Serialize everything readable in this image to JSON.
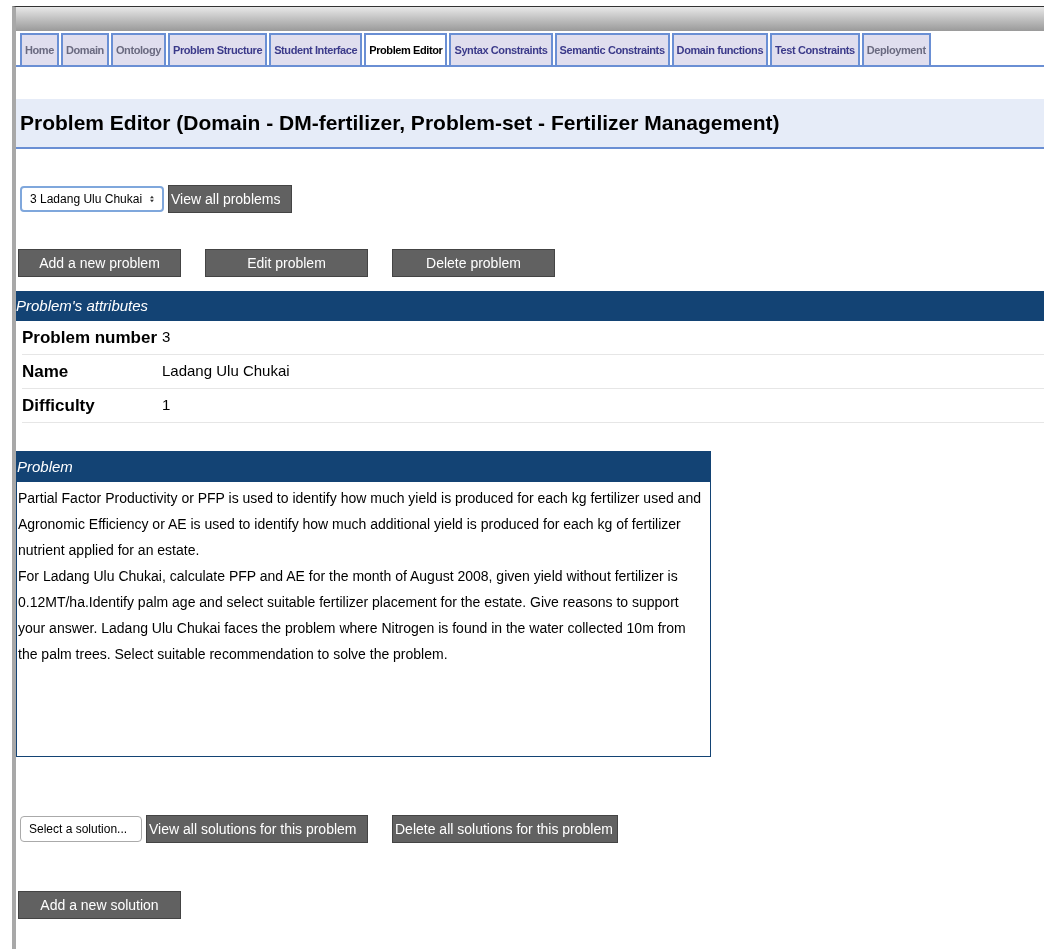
{
  "tabs": [
    {
      "label": "Home",
      "selected": false,
      "dimmed": true
    },
    {
      "label": "Domain",
      "selected": false,
      "dimmed": true
    },
    {
      "label": "Ontology",
      "selected": false,
      "dimmed": true
    },
    {
      "label": "Problem Structure",
      "selected": false,
      "dimmed": false
    },
    {
      "label": "Student Interface",
      "selected": false,
      "dimmed": false
    },
    {
      "label": "Problem Editor",
      "selected": true,
      "dimmed": false
    },
    {
      "label": "Syntax Constraints",
      "selected": false,
      "dimmed": false
    },
    {
      "label": "Semantic Constraints",
      "selected": false,
      "dimmed": false
    },
    {
      "label": "Domain functions",
      "selected": false,
      "dimmed": false
    },
    {
      "label": "Test Constraints",
      "selected": false,
      "dimmed": false
    },
    {
      "label": "Deployment",
      "selected": false,
      "dimmed": true
    }
  ],
  "page_title": "Problem Editor (Domain - DM-fertilizer, Problem-set - Fertilizer Management)",
  "problem_select": {
    "value": "3 Ladang Ulu Chukai"
  },
  "view_all_button": "View all problems",
  "problem_buttons": [
    "Add a new problem",
    "Edit problem",
    "Delete problem"
  ],
  "attributes": {
    "heading": "Problem's attributes",
    "rows": [
      {
        "label": "Problem number",
        "value": "3"
      },
      {
        "label": "Name",
        "value": "Ladang Ulu Chukai"
      },
      {
        "label": "Difficulty",
        "value": "1"
      }
    ]
  },
  "problem": {
    "heading": "Problem",
    "paragraphs": [
      "Partial Factor Productivity or PFP is used to identify how much yield is produced for each kg fertilizer used and Agronomic Efficiency or AE is used to identify how much additional yield is produced for each kg of fertilizer nutrient applied for an estate.",
      "For Ladang Ulu Chukai, calculate PFP and AE for the month of August 2008, given yield without fertilizer is 0.12MT/ha.Identify palm age and select suitable fertilizer placement for the estate. Give reasons to support your answer. Ladang Ulu Chukai faces the problem where Nitrogen is found in the water collected 10m from the palm trees. Select suitable recommendation to solve the problem."
    ]
  },
  "solution_select": {
    "value": "Select a solution..."
  },
  "solution_buttons": [
    "View all solutions for this problem",
    "Delete all solutions for this problem"
  ],
  "add_solution_button": "Add a new solution"
}
